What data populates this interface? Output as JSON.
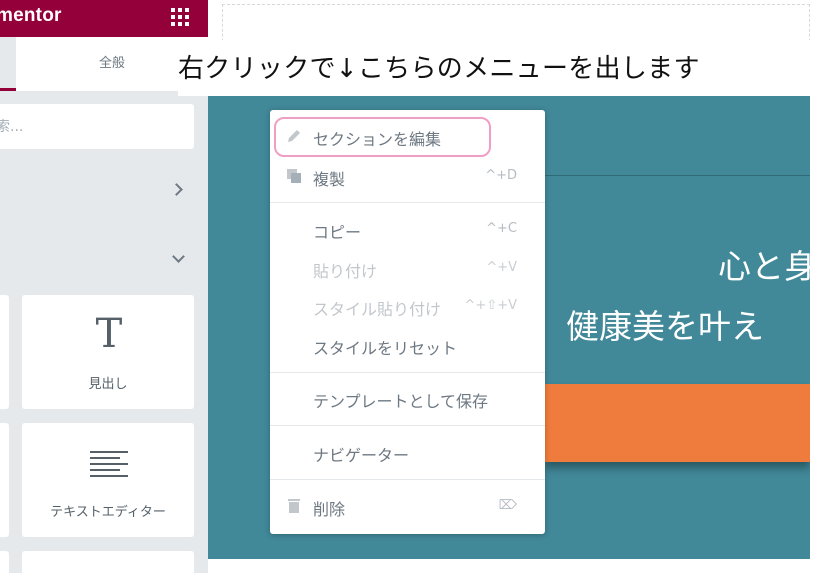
{
  "panel": {
    "brand": "mentor",
    "tab_general": "全般",
    "search_placeholder": "索...",
    "widgets": [
      {
        "label": "見出し",
        "icon": "heading-icon"
      },
      {
        "label": "テキストエディター",
        "icon": "text-editor-icon"
      }
    ]
  },
  "caption": "右クリックで↓こちらのメニューを出します",
  "canvas": {
    "hero_line1": "心と身",
    "hero_line2": "健康美を叶え"
  },
  "menu": {
    "items": [
      {
        "label": "セクションを編集",
        "shortcut": "",
        "icon": "pencil-icon",
        "state": "active"
      },
      {
        "label": "複製",
        "shortcut": "^+D",
        "icon": "duplicate-icon",
        "state": "normal"
      },
      {
        "label": "コピー",
        "shortcut": "^+C",
        "state": "normal"
      },
      {
        "label": "貼り付け",
        "shortcut": "^+V",
        "state": "disabled"
      },
      {
        "label": "スタイル貼り付け",
        "shortcut": "^+⇧+V",
        "state": "disabled"
      },
      {
        "label": "スタイルをリセット",
        "shortcut": "",
        "state": "normal"
      },
      {
        "label": "テンプレートとして保存",
        "shortcut": "",
        "state": "normal"
      },
      {
        "label": "ナビゲーター",
        "shortcut": "",
        "state": "normal"
      },
      {
        "label": "削除",
        "shortcut": "⌦",
        "icon": "trash-icon",
        "state": "normal"
      }
    ]
  },
  "colors": {
    "brand": "#93003a",
    "section": "#418899",
    "accent_button": "#ef7c3c",
    "highlight": "#ef9fc4"
  }
}
